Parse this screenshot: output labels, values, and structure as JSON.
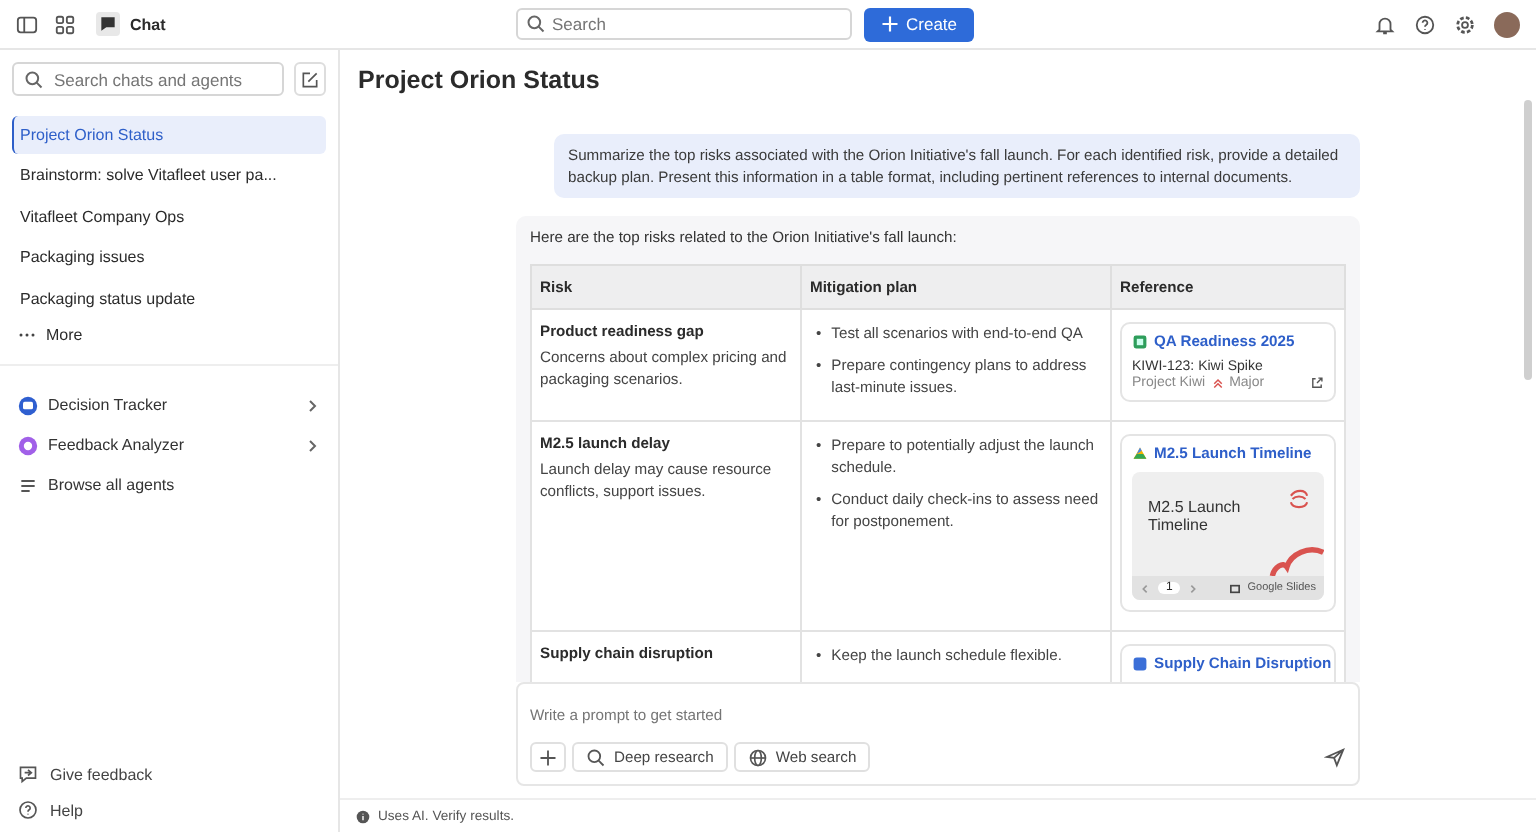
{
  "topbar": {
    "app_label": "Chat",
    "search_placeholder": "Search",
    "create_label": "Create"
  },
  "sidebar": {
    "search_placeholder": "Search chats and agents",
    "chats": [
      {
        "label": "Project Orion Status",
        "selected": true
      },
      {
        "label": "Brainstorm: solve Vitafleet user pa...",
        "selected": false
      },
      {
        "label": "Vitafleet Company Ops",
        "selected": false
      },
      {
        "label": "Packaging issues",
        "selected": false
      },
      {
        "label": "Packaging status update",
        "selected": false
      }
    ],
    "more_label": "More",
    "agents": [
      {
        "label": "Decision Tracker",
        "kind": "tracker"
      },
      {
        "label": "Feedback Analyzer",
        "kind": "analyzer"
      },
      {
        "label": "Browse all agents",
        "kind": "browse"
      }
    ],
    "footer_links": [
      {
        "label": "Give feedback",
        "kind": "feedback"
      },
      {
        "label": "Help",
        "kind": "help"
      }
    ]
  },
  "main": {
    "title": "Project Orion Status",
    "prompt": "Summarize the top risks associated with the Orion Initiative's fall launch. For each identified risk, provide a detailed backup plan. Present this information in a table format, including pertinent references to internal documents.",
    "response_intro": "Here are the top risks related to the Orion Initiative's fall launch:",
    "table": {
      "bullet": "•",
      "columns": [
        "Risk",
        "Mitigation plan",
        "Reference"
      ],
      "rows": [
        {
          "risk_title": "Product readiness gap",
          "risk_desc": "Concerns about complex pricing and packaging scenarios.",
          "mitigations": [
            "Test all scenarios with end-to-end QA",
            "Prepare contingency plans to address last-minute issues."
          ],
          "reference": {
            "kind": "issue",
            "title": "QA Readiness 2025",
            "issue": "KIWI-123: Kiwi Spike",
            "project": "Project Kiwi",
            "priority": "Major"
          }
        },
        {
          "risk_title": "M2.5 launch delay",
          "risk_desc": "Launch delay may cause resource conflicts, support issues.",
          "mitigations": [
            "Prepare to potentially adjust the launch schedule.",
            "Conduct daily check-ins to assess need for postponement."
          ],
          "reference": {
            "kind": "slides",
            "title": "M2.5 Launch Timeline",
            "slide_title": "M2.5 Launch Timeline",
            "page": "1",
            "source": "Google Slides"
          }
        },
        {
          "risk_title": "Supply chain disruption",
          "mitigations": [
            "Keep the launch schedule flexible."
          ],
          "reference": {
            "kind": "link",
            "title": "Supply Chain Disruption"
          }
        }
      ]
    }
  },
  "composer": {
    "placeholder": "Write a prompt to get started",
    "tools": [
      {
        "label": "Deep research",
        "kind": "search"
      },
      {
        "label": "Web search",
        "kind": "globe"
      }
    ]
  },
  "status_bar": "Uses AI. Verify results."
}
